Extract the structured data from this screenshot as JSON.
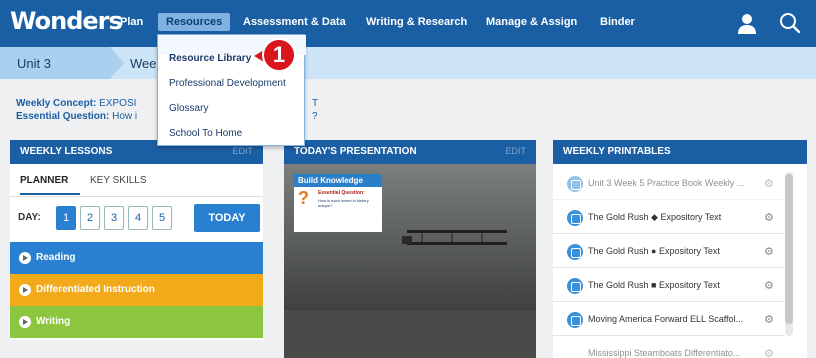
{
  "app": {
    "logo": "Wonders"
  },
  "nav": {
    "items": [
      "Plan",
      "Resources",
      "Assessment & Data",
      "Writing & Research",
      "Manage & Assign",
      "Binder"
    ],
    "active": "Resources",
    "icons": [
      "user-icon",
      "search-icon"
    ]
  },
  "unitbar": {
    "unit": "Unit 3",
    "week": "Wee"
  },
  "concept": {
    "weekly_label": "Weekly Concept:",
    "weekly_value": "EXPOSI",
    "weekly_right": "T",
    "essential_label": "Essential Question:",
    "essential_value": "How i",
    "essential_right": "?"
  },
  "dropdown": {
    "items": [
      "Resource Library",
      "Professional Development",
      "Glossary",
      "School To Home"
    ],
    "highlighted": "Resource Library"
  },
  "callout": {
    "number": "1",
    "color": "#d8161b"
  },
  "weekly_lessons": {
    "title": "WEEKLY LESSONS",
    "edit": "EDIT",
    "tabs": [
      "PLANNER",
      "KEY SKILLS"
    ],
    "active_tab": "PLANNER",
    "day_label": "DAY:",
    "days": [
      "1",
      "2",
      "3",
      "4",
      "5"
    ],
    "active_day": "1",
    "today": "TODAY",
    "rows": [
      {
        "label": "Reading",
        "color": "#2a80d0"
      },
      {
        "label": "Differentiated Instruction",
        "color": "#f2a91a"
      },
      {
        "label": "Writing",
        "color": "#8cc63f"
      }
    ]
  },
  "presentation": {
    "title": "TODAY'S PRESENTATION",
    "edit": "EDIT",
    "bk_title": "Build Knowledge",
    "bk_question_mark": "?",
    "bk_eq": "Essential Question:",
    "bk_sub": "How is each invent in history unique?"
  },
  "printables": {
    "title": "WEEKLY PRINTABLES",
    "items": [
      "Unit 3 Week 5 Practice Book Weekly ...",
      "The Gold Rush ◆ Expository Text",
      "The Gold Rush ● Expository Text",
      "The Gold Rush ■ Expository Text",
      "Moving America Forward  ELL Scaffol...",
      "Mississippi Steamboats Differentiato..."
    ],
    "gear": "⚙"
  },
  "colors": {
    "brand": "#1a5fa4",
    "light": "#cde4f6",
    "accent": "#2a80d0"
  }
}
